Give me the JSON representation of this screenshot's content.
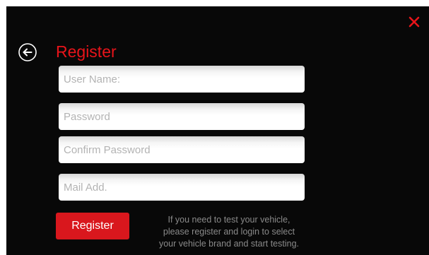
{
  "header": {
    "title": "Register",
    "back_icon": "back-arrow-icon",
    "close_icon": "close-icon",
    "accent_color": "#e8141a"
  },
  "form": {
    "username_placeholder": "User Name:",
    "password_placeholder": "Password",
    "confirm_password_placeholder": "Confirm Password",
    "mail_placeholder": "Mail Add.",
    "register_label": "Register"
  },
  "hint": {
    "lines": [
      "If you need to test your vehicle,",
      "please register and login to select",
      "your vehicle brand and start testing."
    ]
  }
}
